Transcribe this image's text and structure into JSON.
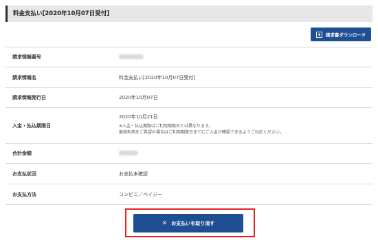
{
  "header": {
    "title": "料金支払い[2020年10月07日受付]"
  },
  "toolbar": {
    "download_label": "請求書ダウンロード",
    "download_icon": "download-icon"
  },
  "rows": [
    {
      "label": "請求情報番号",
      "value": ""
    },
    {
      "label": "請求情報名",
      "value": "料金支払い[2020年10月07日受付]"
    },
    {
      "label": "請求情報発行日",
      "value": "2020年10月07日"
    },
    {
      "label": "入金・払込期限日",
      "value": "2020年10月21日",
      "notes": [
        "※入金・払込期限はご利用期限日とは異なります。",
        "継続利用をご希望の場合はご利用期限日までにご入金が確認できるようご対応ください。"
      ]
    },
    {
      "label": "合計金額",
      "value": ""
    },
    {
      "label": "お支払状況",
      "value": "お支払未確認"
    },
    {
      "label": "お支払方法",
      "value": "コンビニ／ペイジー"
    }
  ],
  "actions": {
    "cancel_label": "お支払いを取り消す",
    "cancel_icon": "close-icon"
  },
  "colors": {
    "primary": "#1f4f93",
    "highlight": "#e12323",
    "header_bg": "#e6e7e8"
  }
}
